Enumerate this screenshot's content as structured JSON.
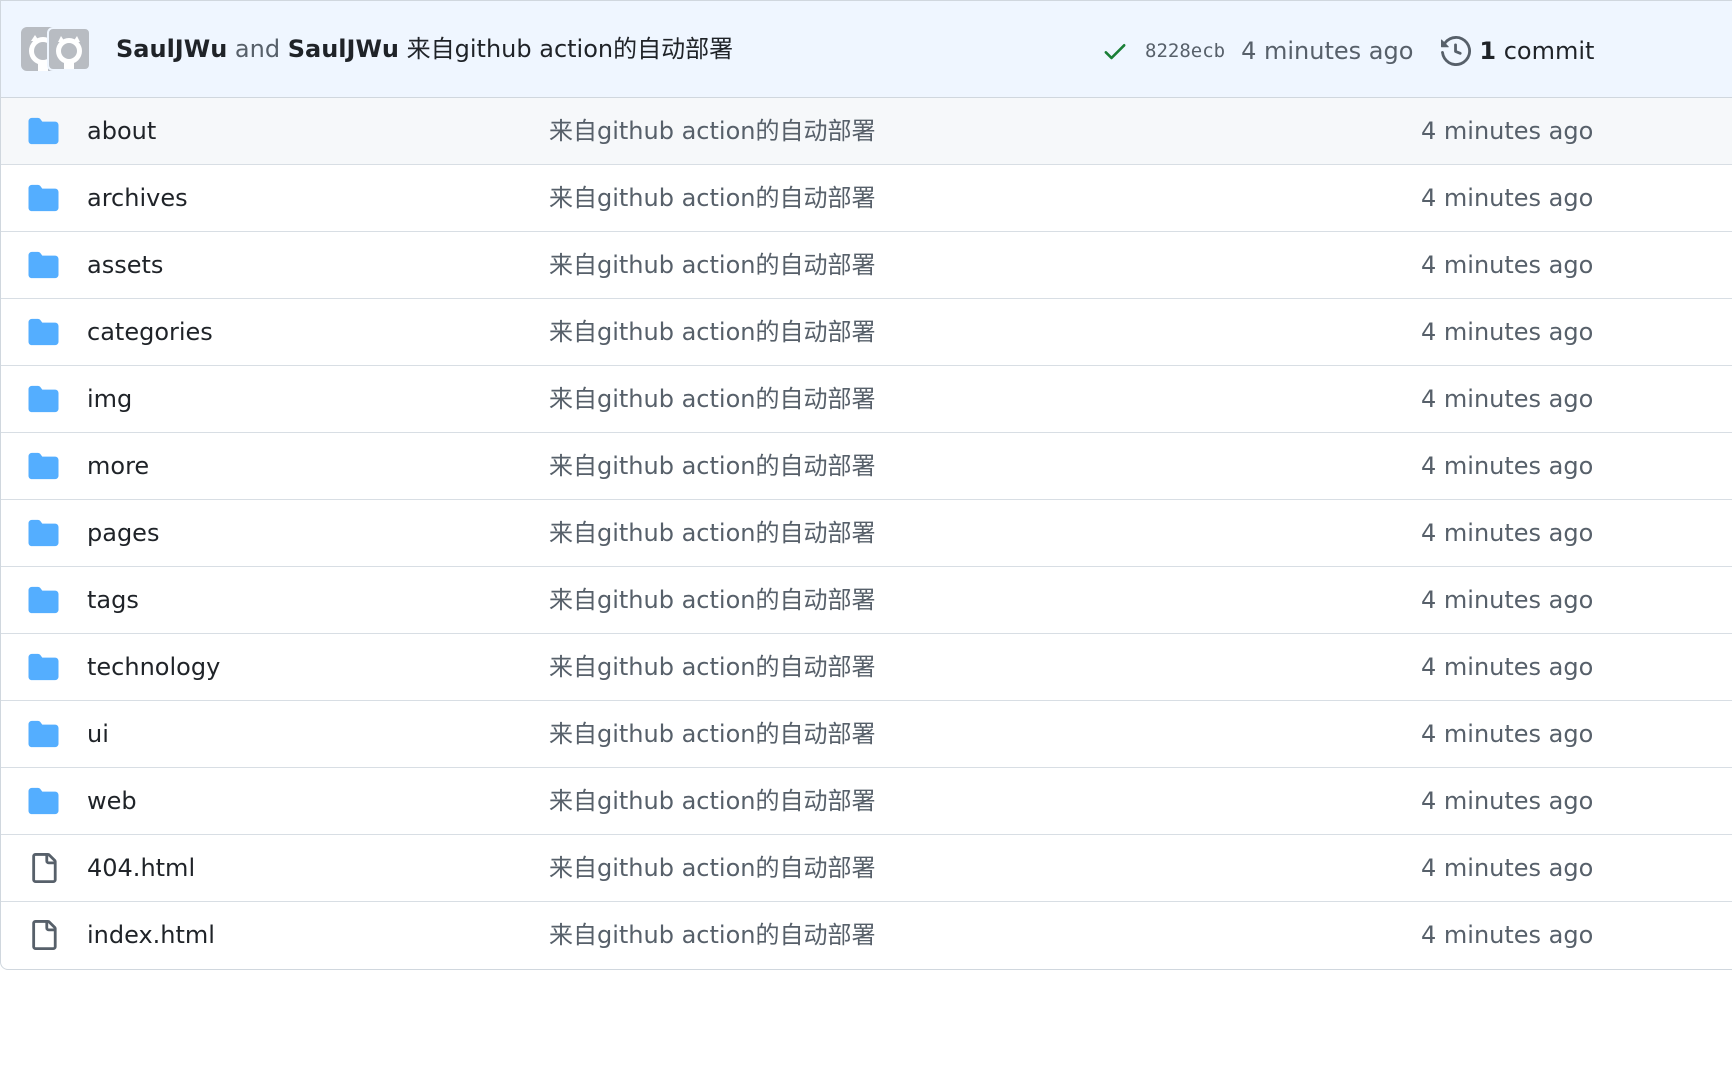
{
  "commit": {
    "author1": "SaulJWu",
    "and_text": "and",
    "author2": "SaulJWu",
    "message": "来自github action的自动部署",
    "sha": "8228ecb",
    "time": "4 minutes ago",
    "commit_count": "1",
    "commit_label": "commit",
    "status": "success",
    "status_color": "#1a7f37"
  },
  "files": [
    {
      "name": "about",
      "type": "folder",
      "message": "来自github action的自动部署",
      "time": "4 minutes ago"
    },
    {
      "name": "archives",
      "type": "folder",
      "message": "来自github action的自动部署",
      "time": "4 minutes ago"
    },
    {
      "name": "assets",
      "type": "folder",
      "message": "来自github action的自动部署",
      "time": "4 minutes ago"
    },
    {
      "name": "categories",
      "type": "folder",
      "message": "来自github action的自动部署",
      "time": "4 minutes ago"
    },
    {
      "name": "img",
      "type": "folder",
      "message": "来自github action的自动部署",
      "time": "4 minutes ago"
    },
    {
      "name": "more",
      "type": "folder",
      "message": "来自github action的自动部署",
      "time": "4 minutes ago"
    },
    {
      "name": "pages",
      "type": "folder",
      "message": "来自github action的自动部署",
      "time": "4 minutes ago"
    },
    {
      "name": "tags",
      "type": "folder",
      "message": "来自github action的自动部署",
      "time": "4 minutes ago"
    },
    {
      "name": "technology",
      "type": "folder",
      "message": "来自github action的自动部署",
      "time": "4 minutes ago"
    },
    {
      "name": "ui",
      "type": "folder",
      "message": "来自github action的自动部署",
      "time": "4 minutes ago"
    },
    {
      "name": "web",
      "type": "folder",
      "message": "来自github action的自动部署",
      "time": "4 minutes ago"
    },
    {
      "name": "404.html",
      "type": "file",
      "message": "来自github action的自动部署",
      "time": "4 minutes ago"
    },
    {
      "name": "index.html",
      "type": "file",
      "message": "来自github action的自动部署",
      "time": "4 minutes ago"
    }
  ],
  "colors": {
    "folder_icon": "#54aeff",
    "file_icon": "#57606a",
    "header_bg": "#eff6ff"
  }
}
